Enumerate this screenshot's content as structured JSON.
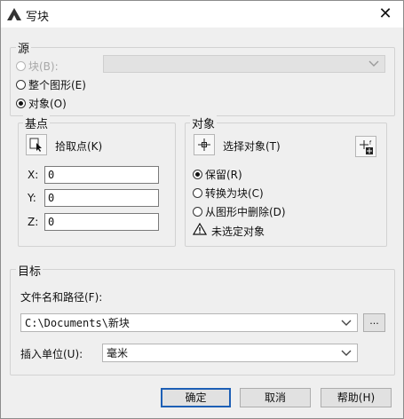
{
  "window": {
    "title": "写块",
    "close_glyph": "✕"
  },
  "source": {
    "group_label": "源",
    "radio_block": "块(B):",
    "radio_entire_drawing": "整个图形(E)",
    "radio_objects": "对象(O)",
    "selected": "对象(O)"
  },
  "base_point": {
    "group_label": "基点",
    "pick_point_label": "拾取点(K)",
    "x_label": "X:",
    "x_value": "0",
    "y_label": "Y:",
    "y_value": "0",
    "z_label": "Z:",
    "z_value": "0"
  },
  "objects": {
    "group_label": "对象",
    "select_objects_label": "选择对象(T)",
    "radio_retain": "保留(R)",
    "radio_convert": "转换为块(C)",
    "radio_delete": "从图形中删除(D)",
    "selected": "保留(R)",
    "warning_text": "未选定对象"
  },
  "destination": {
    "group_label": "目标",
    "path_label": "文件名和路径(F):",
    "path_value": "C:\\Documents\\新块",
    "browse_label": "...",
    "units_label": "插入单位(U):",
    "units_value": "毫米"
  },
  "buttons": {
    "ok": "确定",
    "cancel": "取消",
    "help": "帮助(H)"
  }
}
